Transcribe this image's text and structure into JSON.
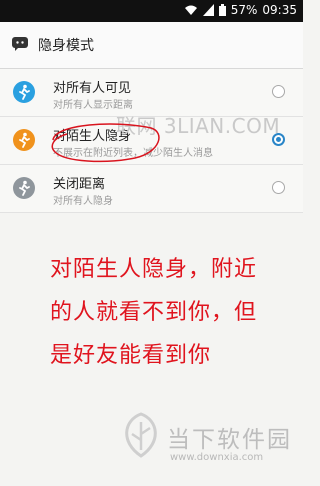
{
  "status_bar": {
    "signal_icon": "signal-icon",
    "battery_percent": "57%",
    "time": "09:35",
    "icons": [
      "wifi-icon",
      "signal-icon",
      "battery-icon"
    ]
  },
  "header": {
    "app_icon": "chat-bubble-icon",
    "title": "隐身模式"
  },
  "options": [
    {
      "icon": "walking-person-icon",
      "icon_color": "#2aa0e0",
      "title": "对所有人可见",
      "subtitle": "对所有人显示距离",
      "selected": false
    },
    {
      "icon": "walking-person-icon",
      "icon_color": "#f0921c",
      "title": "对陌生人隐身",
      "subtitle": "不展示在附近列表，减少陌生人消息",
      "selected": true
    },
    {
      "icon": "walking-person-icon",
      "icon_color": "#8f969c",
      "title": "关闭距离",
      "subtitle": "对所有人隐身",
      "selected": false
    }
  ],
  "watermark_text": "联网 3LIAN.COM",
  "annotation_lines": [
    "对陌生人隐身，附近",
    "的人就看不到你，但",
    "是好友能看到你"
  ],
  "annotation_color": "#e0141e",
  "footer": {
    "brand": "当下软件园",
    "url": "www.downxia.com"
  }
}
